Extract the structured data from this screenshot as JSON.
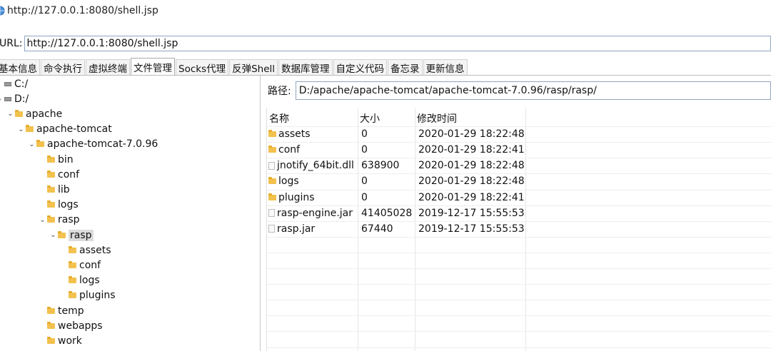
{
  "window": {
    "title": "http://127.0.0.1:8080/shell.jsp"
  },
  "urlbar": {
    "label": "URL:",
    "value": "http://127.0.0.1:8080/shell.jsp"
  },
  "tabs": [
    "基本信息",
    "命令执行",
    "虚拟终端",
    "文件管理",
    "Socks代理",
    "反弹Shell",
    "数据库管理",
    "自定义代码",
    "备忘录",
    "更新信息"
  ],
  "active_tab": "文件管理",
  "tree": [
    {
      "label": "C:/",
      "type": "drive",
      "depth": 0,
      "arrow": ""
    },
    {
      "label": "D:/",
      "type": "drive",
      "depth": 0,
      "arrow": "⌄"
    },
    {
      "label": "apache",
      "type": "folder",
      "depth": 1,
      "arrow": "⌄"
    },
    {
      "label": "apache-tomcat",
      "type": "folder",
      "depth": 2,
      "arrow": "⌄"
    },
    {
      "label": "apache-tomcat-7.0.96",
      "type": "folder",
      "depth": 3,
      "arrow": "⌄"
    },
    {
      "label": "bin",
      "type": "folder",
      "depth": 4,
      "arrow": ""
    },
    {
      "label": "conf",
      "type": "folder",
      "depth": 4,
      "arrow": ""
    },
    {
      "label": "lib",
      "type": "folder",
      "depth": 4,
      "arrow": ""
    },
    {
      "label": "logs",
      "type": "folder",
      "depth": 4,
      "arrow": ""
    },
    {
      "label": "rasp",
      "type": "folder",
      "depth": 4,
      "arrow": "⌄"
    },
    {
      "label": "rasp",
      "type": "folder",
      "depth": 5,
      "arrow": "⌄",
      "selected": true
    },
    {
      "label": "assets",
      "type": "folder",
      "depth": 6,
      "arrow": ""
    },
    {
      "label": "conf",
      "type": "folder",
      "depth": 6,
      "arrow": ""
    },
    {
      "label": "logs",
      "type": "folder",
      "depth": 6,
      "arrow": ""
    },
    {
      "label": "plugins",
      "type": "folder",
      "depth": 6,
      "arrow": ""
    },
    {
      "label": "temp",
      "type": "folder",
      "depth": 4,
      "arrow": ""
    },
    {
      "label": "webapps",
      "type": "folder",
      "depth": 4,
      "arrow": ""
    },
    {
      "label": "work",
      "type": "folder",
      "depth": 4,
      "arrow": ""
    }
  ],
  "path": {
    "label": "路径:",
    "value": "D:/apache/apache-tomcat/apache-tomcat-7.0.96/rasp/rasp/"
  },
  "files": {
    "columns": [
      "名称",
      "大小",
      "修改时间"
    ],
    "rows": [
      {
        "name": "assets",
        "type": "folder",
        "size": "0",
        "modified": "2020-01-29 18:22:48"
      },
      {
        "name": "conf",
        "type": "folder",
        "size": "0",
        "modified": "2020-01-29 18:22:41"
      },
      {
        "name": "jnotify_64bit.dll",
        "type": "file",
        "size": "638900",
        "modified": "2020-01-29 18:22:48"
      },
      {
        "name": "logs",
        "type": "folder",
        "size": "0",
        "modified": "2020-01-29 18:22:48"
      },
      {
        "name": "plugins",
        "type": "folder",
        "size": "0",
        "modified": "2020-01-29 18:22:41"
      },
      {
        "name": "rasp-engine.jar",
        "type": "file",
        "size": "41405028",
        "modified": "2019-12-17 15:55:53"
      },
      {
        "name": "rasp.jar",
        "type": "file",
        "size": "67440",
        "modified": "2019-12-17 15:55:53"
      }
    ]
  }
}
